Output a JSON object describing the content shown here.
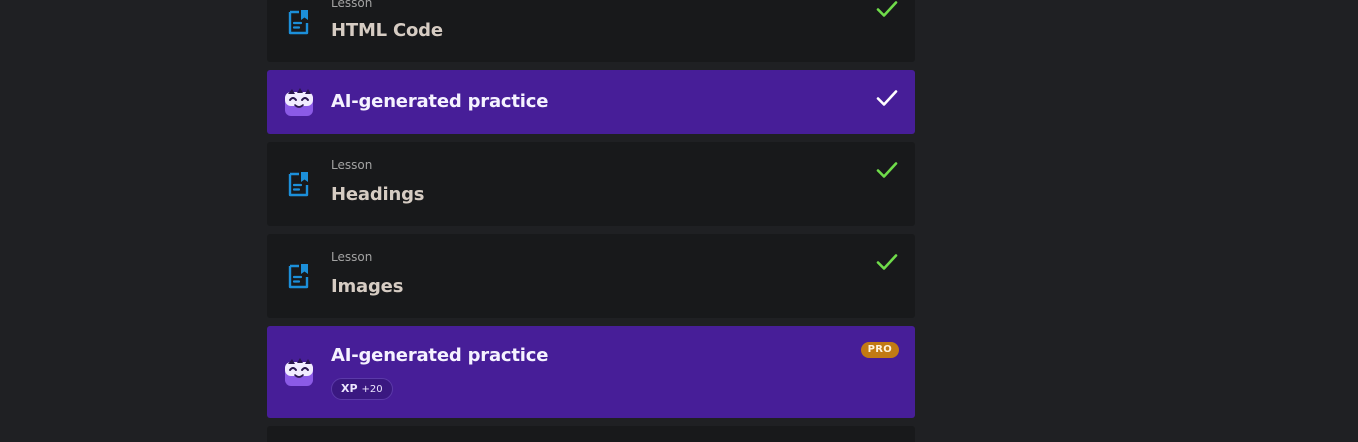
{
  "colors": {
    "page_bg": "#1f2023",
    "lesson_card_bg": "#18191b",
    "ai_card_bg": "#471e98",
    "check_green": "#6fdc4a",
    "check_white": "#ffffff",
    "lesson_icon_blue": "#1c8fd9",
    "pro_badge": "#c27a14"
  },
  "items": [
    {
      "type": "lesson",
      "kind_label": "Lesson",
      "title": "HTML Code",
      "completed": true,
      "icon": "lesson-document-icon",
      "status_icon": "check-icon"
    },
    {
      "type": "ai-practice",
      "title": "AI-generated practice",
      "completed": true,
      "icon": "ai-mascot-icon",
      "status_icon": "check-icon"
    },
    {
      "type": "lesson",
      "kind_label": "Lesson",
      "title": "Headings",
      "completed": true,
      "icon": "lesson-document-icon",
      "status_icon": "check-icon"
    },
    {
      "type": "lesson",
      "kind_label": "Lesson",
      "title": "Images",
      "completed": true,
      "icon": "lesson-document-icon",
      "status_icon": "check-icon"
    },
    {
      "type": "ai-practice",
      "title": "AI-generated practice",
      "completed": false,
      "icon": "ai-mascot-icon",
      "badge": "PRO",
      "xp_label": "XP",
      "xp_value": "+20"
    }
  ]
}
